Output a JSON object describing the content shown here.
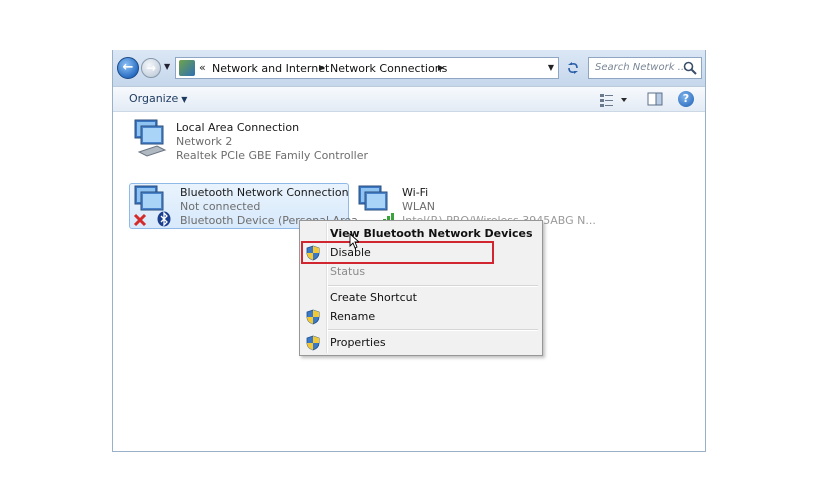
{
  "address_bar": {
    "overflow": "«",
    "crumbs": [
      "Network and Internet",
      "Network Connections"
    ],
    "search_placeholder": "Search Network ..."
  },
  "command_bar": {
    "organize_label": "Organize"
  },
  "connections": [
    {
      "name": "Local Area Connection",
      "status": "Network  2",
      "device": "Realtek PCIe GBE Family Controller"
    },
    {
      "name": "Bluetooth Network Connection",
      "status": "Not connected",
      "device": "Bluetooth Device (Personal Area"
    },
    {
      "name": "Wi-Fi",
      "status": "WLAN",
      "device": "Intel(R) PRO/Wireless 3945ABG N..."
    }
  ],
  "context_menu": {
    "items": [
      {
        "label": "View Bluetooth Network Devices",
        "bold": true
      },
      {
        "label": "Disable",
        "shield": true,
        "highlighted": true
      },
      {
        "label": "Status",
        "disabled": true
      },
      {
        "label": "Create Shortcut"
      },
      {
        "label": "Rename",
        "shield": true
      },
      {
        "label": "Properties",
        "shield": true
      }
    ]
  },
  "colors": {
    "highlight": "#d1252f",
    "selection": "#d7e9fb"
  }
}
